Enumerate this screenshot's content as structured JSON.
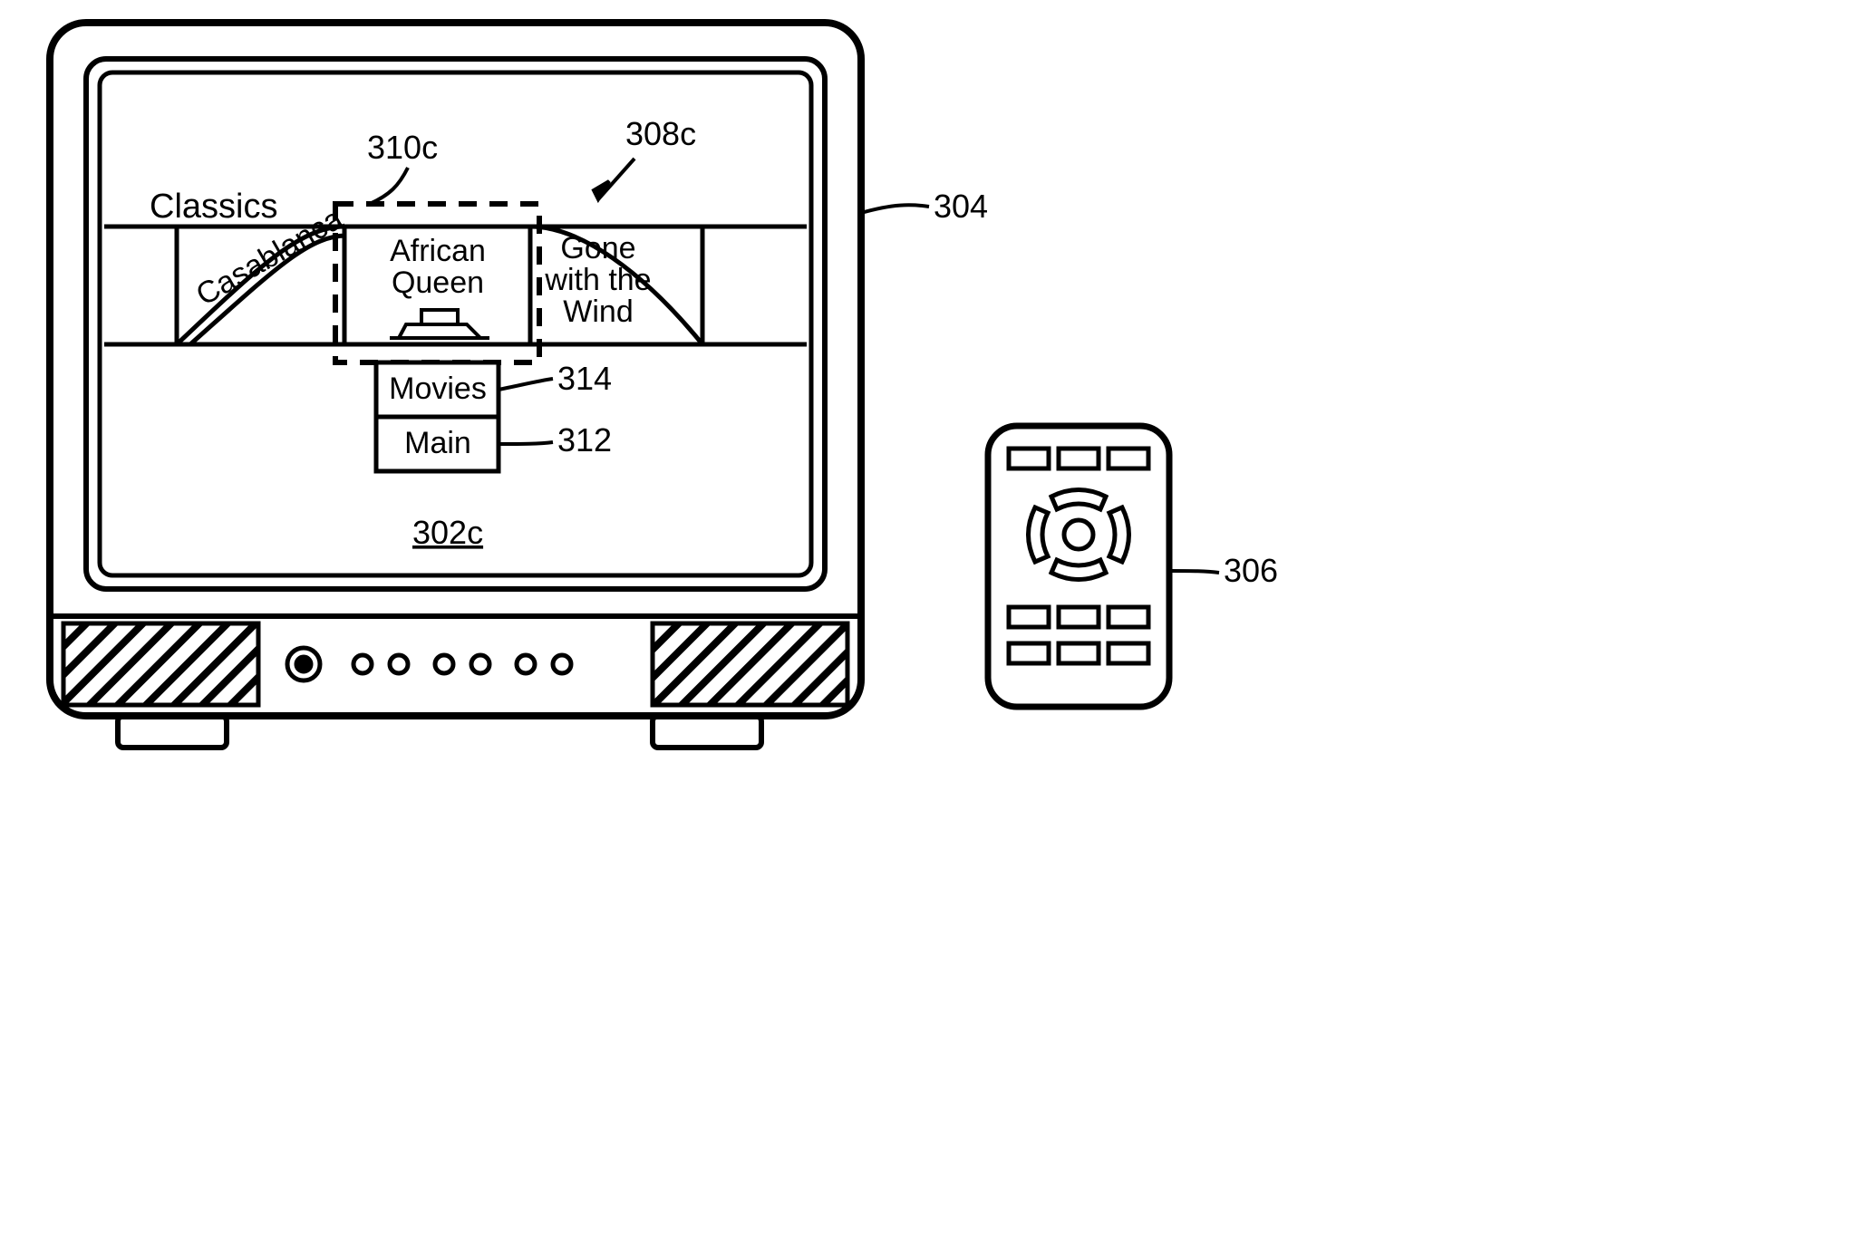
{
  "refs": {
    "tv": "304",
    "remote": "306",
    "screen": "302c",
    "carousel": "308c",
    "focus": "310c",
    "menu_top": "314",
    "menu_bot": "312"
  },
  "carousel": {
    "category": "Classics",
    "left": "Casablanca",
    "center_line1": "African",
    "center_line2": "Queen",
    "right_line1": "Gone",
    "right_line2": "with the",
    "right_line3": "Wind"
  },
  "menu": {
    "top": "Movies",
    "bottom": "Main"
  }
}
